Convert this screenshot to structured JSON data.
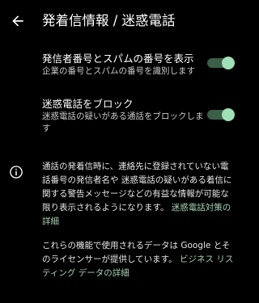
{
  "header": {
    "back_icon": "arrow-back-icon",
    "title": "発着信情報 / 迷惑電話"
  },
  "settings": [
    {
      "title": "発信者番号とスパムの番号を表示",
      "subtitle": "企業の番号とスパムの番号を識別します",
      "enabled": true
    },
    {
      "title": "迷惑電話をブロック",
      "subtitle": "迷惑電話の疑いがある通話をブロックします",
      "enabled": true
    }
  ],
  "info": {
    "icon": "info-icon",
    "paragraph1_text": "通話の発着信時に、連絡先に登録されていない電話番号の発信者名や 迷惑電話の疑いがある着信に関する警告メッセージなどの有益な情報が可能な限り表示されるようになります。",
    "paragraph1_link": "迷惑電話対策の詳細",
    "paragraph2_text": "これらの機能で使用されるデータは Google とそのライセンサーが提供しています。",
    "paragraph2_link": "ビジネス リスティング データの詳細"
  },
  "colors": {
    "background": "#000000",
    "toggle_thumb": "#9fe0b4",
    "toggle_track": "#3b5e49",
    "link": "#a9d3b5"
  }
}
